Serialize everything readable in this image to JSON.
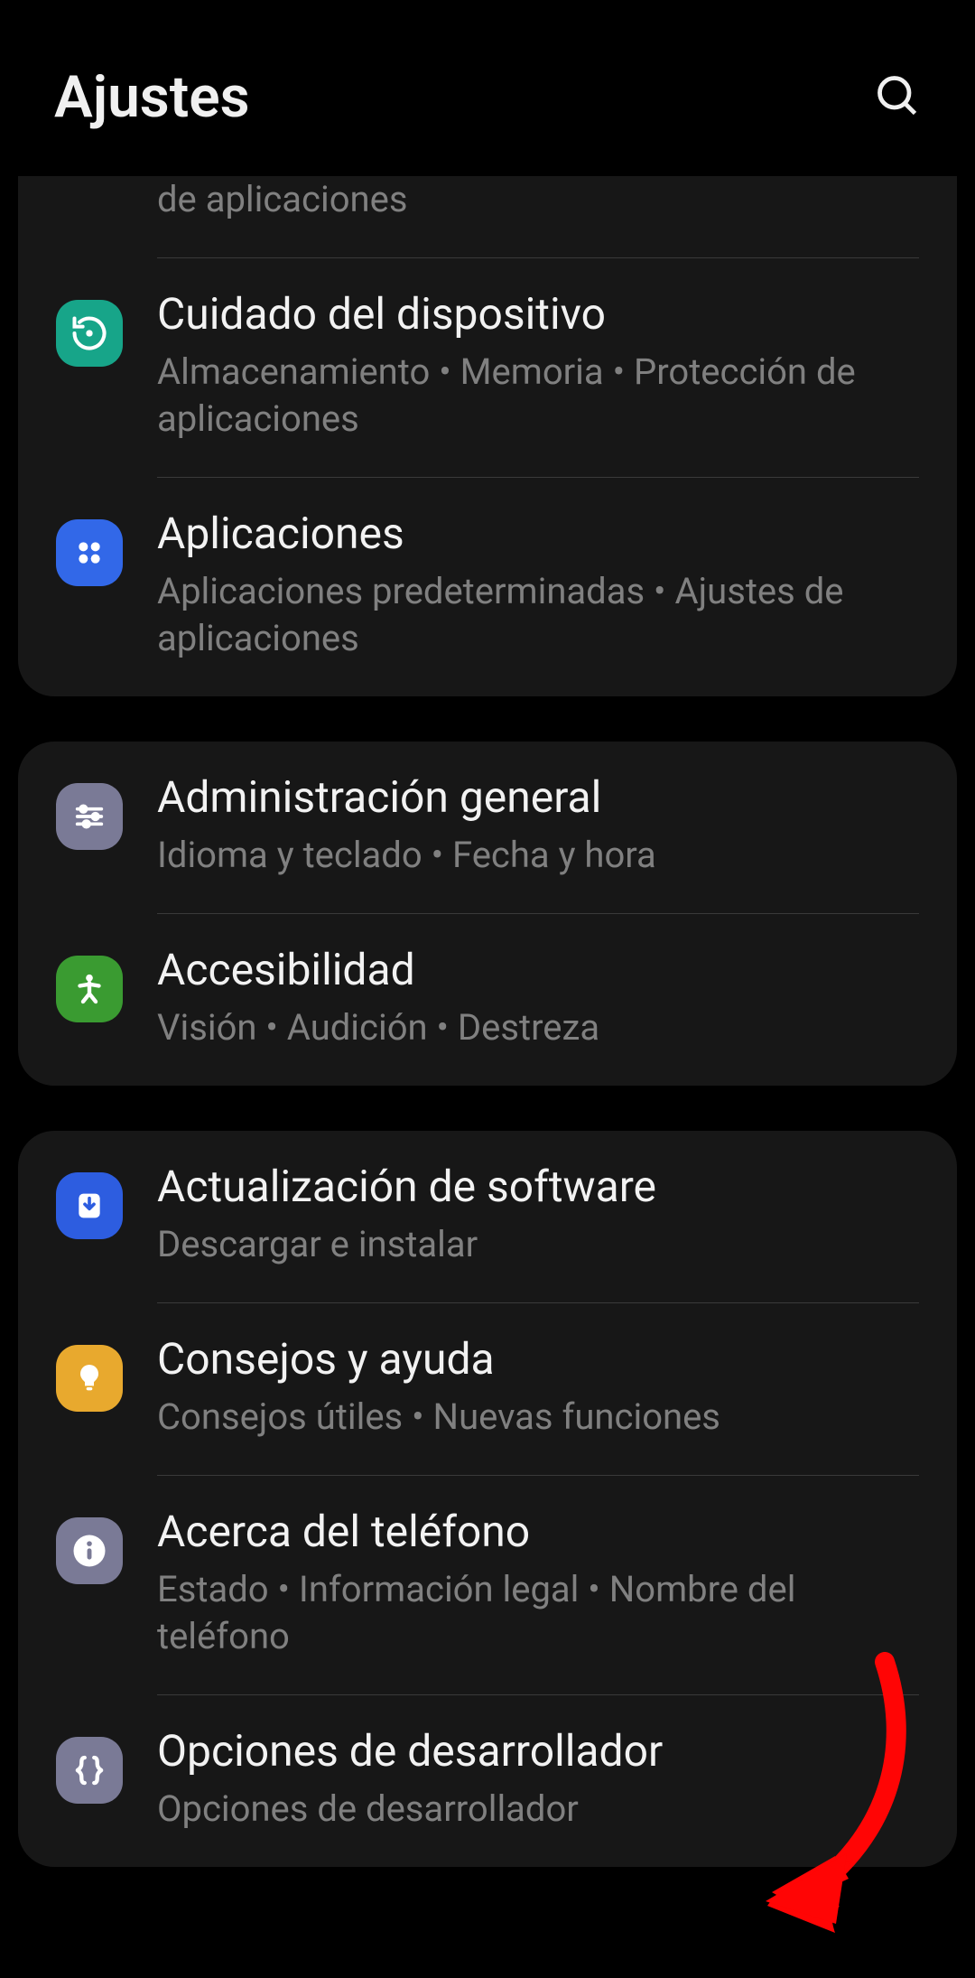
{
  "header": {
    "title": "Ajustes"
  },
  "groups": [
    {
      "items": [
        {
          "id": "truncated",
          "subtitle": "de aplicaciones",
          "truncated": true
        },
        {
          "id": "device-care",
          "title": "Cuidado del dispositivo",
          "subtitle": "Almacenamiento  •  Memoria  •  Protección de aplicaciones",
          "icon": "refresh-icon",
          "icon_bg": "bg-teal"
        },
        {
          "id": "applications",
          "title": "Aplicaciones",
          "subtitle": "Aplicaciones predeterminadas  •  Ajustes de aplicaciones",
          "icon": "four-dots-icon",
          "icon_bg": "bg-blue"
        }
      ]
    },
    {
      "items": [
        {
          "id": "general-management",
          "title": "Administración general",
          "subtitle": "Idioma y teclado  •  Fecha y hora",
          "icon": "sliders-icon",
          "icon_bg": "bg-slate"
        },
        {
          "id": "accessibility",
          "title": "Accesibilidad",
          "subtitle": "Visión  •  Audición  •  Destreza",
          "icon": "person-icon",
          "icon_bg": "bg-green"
        }
      ]
    },
    {
      "items": [
        {
          "id": "software-update",
          "title": "Actualización de software",
          "subtitle": "Descargar e instalar",
          "icon": "download-icon",
          "icon_bg": "bg-bblue"
        },
        {
          "id": "tips-help",
          "title": "Consejos y ayuda",
          "subtitle": "Consejos útiles  •  Nuevas funciones",
          "icon": "lightbulb-icon",
          "icon_bg": "bg-amber"
        },
        {
          "id": "about-phone",
          "title": "Acerca del teléfono",
          "subtitle": "Estado  •  Información legal  •  Nombre del teléfono",
          "icon": "info-icon",
          "icon_bg": "bg-slate"
        },
        {
          "id": "developer-options",
          "title": "Opciones de desarrollador",
          "subtitle": "Opciones de desarrollador",
          "icon": "braces-icon",
          "icon_bg": "bg-slate"
        }
      ]
    }
  ],
  "annotation": {
    "type": "arrow",
    "color": "#ff0000",
    "points_to": "developer-options"
  }
}
